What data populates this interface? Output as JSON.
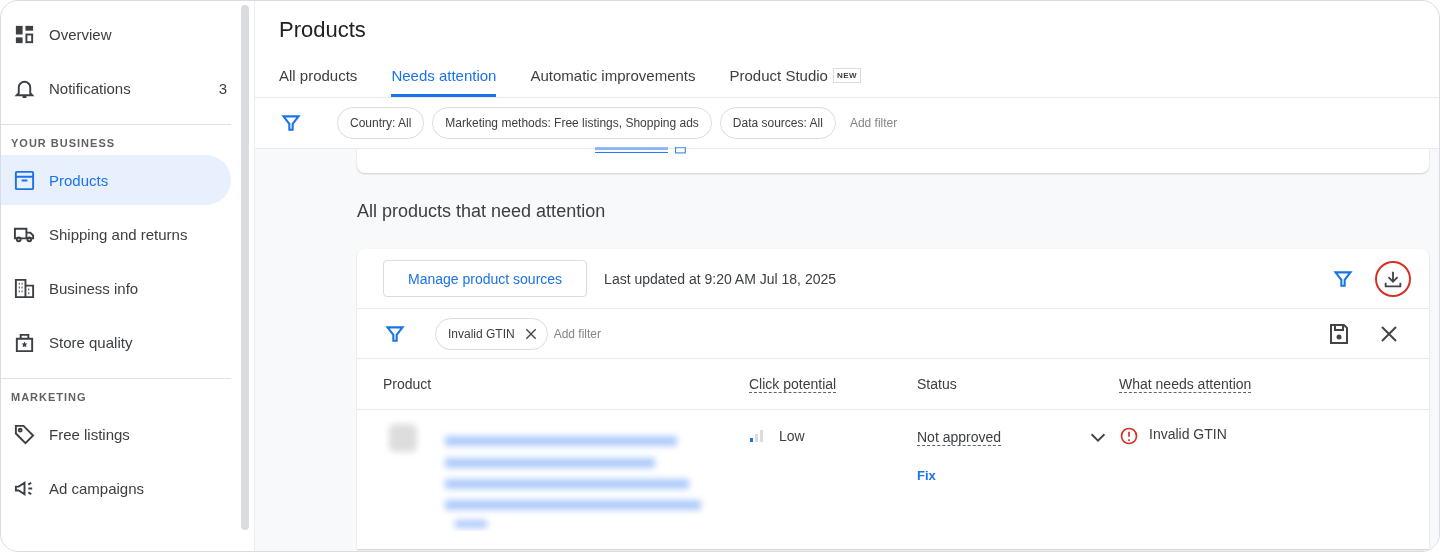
{
  "sidebar": {
    "sections": [
      {
        "items": [
          {
            "label": "Overview",
            "selected": false
          },
          {
            "label": "Notifications",
            "selected": false,
            "count": "3"
          }
        ]
      },
      {
        "label": "YOUR BUSINESS",
        "items": [
          {
            "label": "Products",
            "selected": true
          },
          {
            "label": "Shipping and returns",
            "selected": false
          },
          {
            "label": "Business info",
            "selected": false
          },
          {
            "label": "Store quality",
            "selected": false
          }
        ]
      },
      {
        "label": "MARKETING",
        "items": [
          {
            "label": "Free listings",
            "selected": false
          },
          {
            "label": "Ad campaigns",
            "selected": false
          }
        ]
      }
    ]
  },
  "page": {
    "title": "Products",
    "tabs": [
      {
        "label": "All products",
        "selected": false
      },
      {
        "label": "Needs attention",
        "selected": true
      },
      {
        "label": "Automatic improvements",
        "selected": false
      },
      {
        "label": "Product Studio",
        "selected": false,
        "badge": "NEW"
      }
    ],
    "filters": {
      "chips": [
        "Country: All",
        "Marketing methods: Free listings, Shopping ads",
        "Data sources: All"
      ],
      "add": "Add filter"
    }
  },
  "section_title": "All products that need attention",
  "table": {
    "manage_button": "Manage product sources",
    "last_updated": "Last updated at 9:20 AM Jul 18, 2025",
    "filters": {
      "chips": [
        "Invalid GTIN"
      ],
      "add": "Add filter"
    },
    "columns": [
      {
        "label": "Product",
        "dotted": false
      },
      {
        "label": "Click potential",
        "dotted": true
      },
      {
        "label": "Status",
        "dotted": false
      },
      {
        "label": "What needs attention",
        "dotted": true
      }
    ],
    "rows": [
      {
        "click_potential": "Low",
        "level": 0.33,
        "status": "Not approved",
        "action": "Fix",
        "issue": "Invalid GTIN"
      }
    ]
  }
}
